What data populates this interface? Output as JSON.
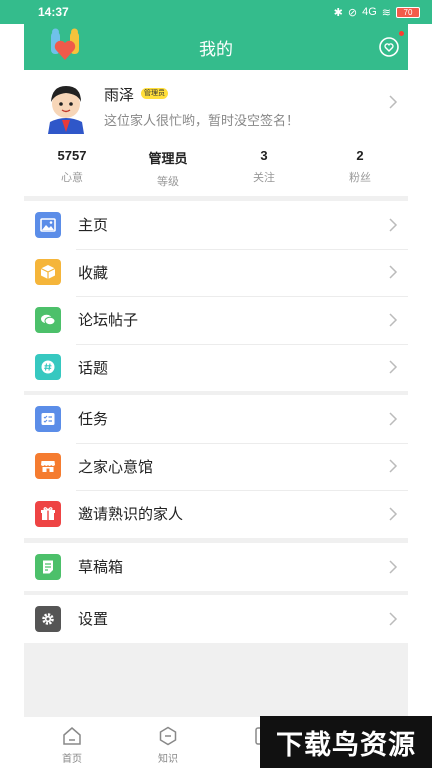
{
  "status_bar": {
    "time": "14:37",
    "signal": "4G",
    "battery": "70"
  },
  "header": {
    "title": "我的",
    "logo_icon": "family-heart-logo",
    "message_icon": "message-heart-icon"
  },
  "profile": {
    "name": "雨泽",
    "role_badge": "管理员",
    "signature": "这位家人很忙哟，暂时没空签名！",
    "stats": [
      {
        "value": "5757",
        "label": "心意"
      },
      {
        "value": "管理员",
        "label": "等级"
      },
      {
        "value": "3",
        "label": "关注"
      },
      {
        "value": "2",
        "label": "粉丝"
      }
    ]
  },
  "menu": {
    "home": {
      "label": "主页",
      "icon": "image-icon",
      "color": "#5b8de8"
    },
    "favorites": {
      "label": "收藏",
      "icon": "box-icon",
      "color": "#f5b53a"
    },
    "forum_posts": {
      "label": "论坛帖子",
      "icon": "chat-bubbles-icon",
      "color": "#4cc06a"
    },
    "topics": {
      "label": "话题",
      "icon": "hashtag-icon",
      "color": "#36c8c0"
    },
    "tasks": {
      "label": "任务",
      "icon": "task-list-icon",
      "color": "#5b8de8"
    },
    "shop": {
      "label": "之家心意馆",
      "icon": "store-icon",
      "color": "#f57c30"
    },
    "invite": {
      "label": "邀请熟识的家人",
      "icon": "gift-icon",
      "color": "#ee4444"
    },
    "drafts": {
      "label": "草稿箱",
      "icon": "draft-icon",
      "color": "#4cc06a"
    },
    "settings": {
      "label": "设置",
      "icon": "gear-icon",
      "color": "#555555"
    }
  },
  "tabbar": [
    {
      "label": "首页",
      "icon": "home-icon"
    },
    {
      "label": "知识",
      "icon": "knowledge-icon"
    }
  ],
  "watermark": "下载鸟资源",
  "colors": {
    "brand": "#34bc8c",
    "background": "#f0f0f0"
  }
}
